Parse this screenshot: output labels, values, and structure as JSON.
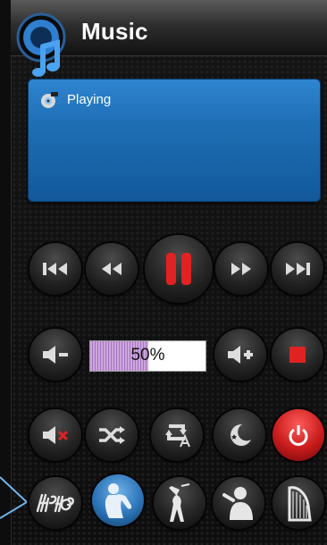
{
  "header": {
    "title": "Music"
  },
  "status": {
    "text": "Playing"
  },
  "volume": {
    "level_percent": 50,
    "label": "50%"
  },
  "colors": {
    "accent_blue": "#1f6fb6",
    "pause_red": "#e02222",
    "power_red": "#c81b1b"
  },
  "icons": [
    "music-note-logo-icon",
    "disc-icon",
    "skip-previous-icon",
    "rewind-icon",
    "pause-icon",
    "fast-forward-icon",
    "skip-next-icon",
    "volume-down-icon",
    "volume-up-icon",
    "stop-icon",
    "mute-icon",
    "shuffle-icon",
    "repeat-a-icon",
    "sleep-timer-icon",
    "power-icon",
    "hiphop-genre-icon",
    "jazz-genre-icon",
    "pop-genre-icon",
    "vocal-genre-icon",
    "classical-genre-icon"
  ]
}
